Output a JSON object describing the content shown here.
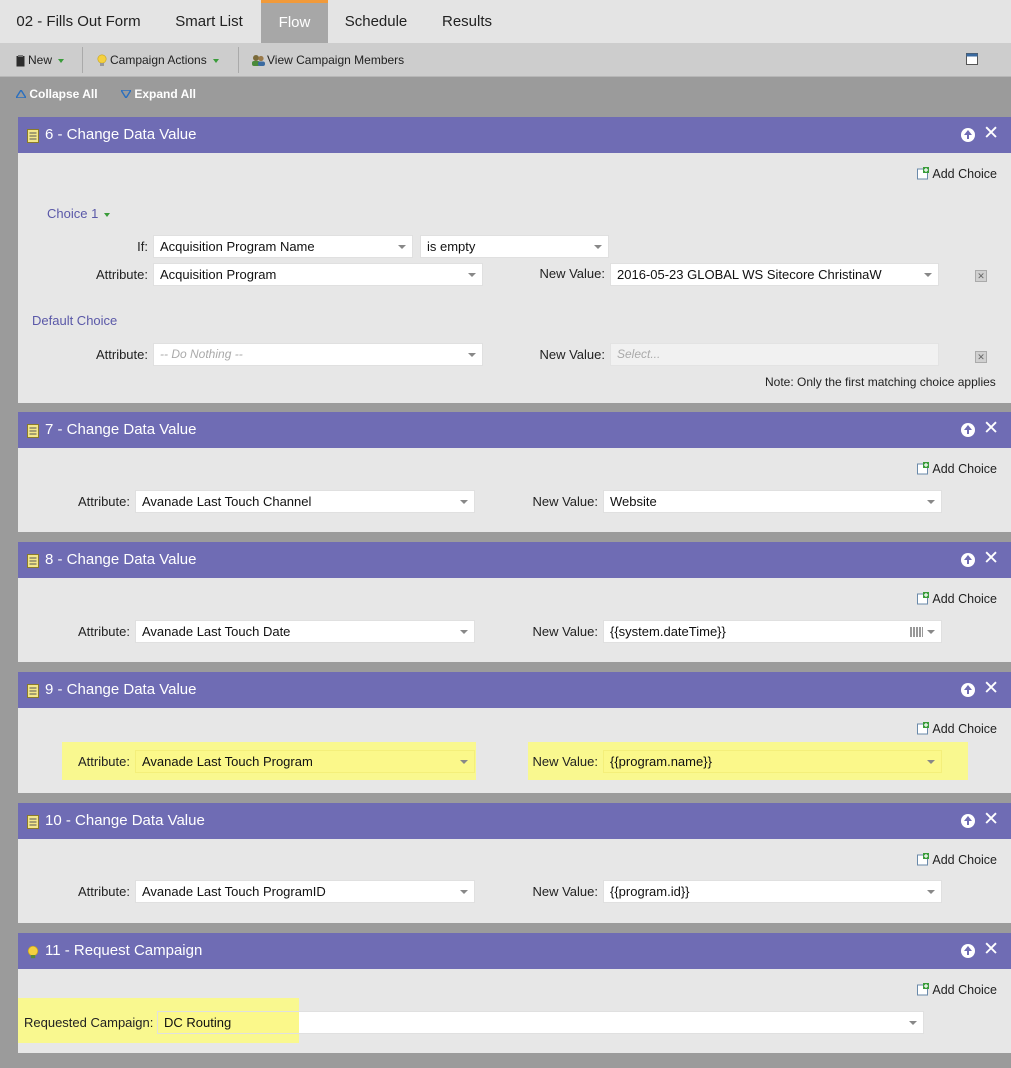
{
  "tabs": [
    {
      "label": "02 - Fills Out Form",
      "active": false
    },
    {
      "label": "Smart List",
      "active": false
    },
    {
      "label": "Flow",
      "active": true
    },
    {
      "label": "Schedule",
      "active": false
    },
    {
      "label": "Results",
      "active": false
    }
  ],
  "toolbar": {
    "new_label": "New",
    "campaign_actions_label": "Campaign Actions",
    "view_members_label": "View Campaign Members"
  },
  "subbar": {
    "collapse_all": "Collapse All",
    "expand_all": "Expand All"
  },
  "colors": {
    "header": "#6f6cb4",
    "highlight": "#fbf88a",
    "active_tab_accent": "#f19a3a"
  },
  "common": {
    "add_choice": "Add Choice",
    "attribute_label": "Attribute:",
    "new_value_label": "New Value:",
    "if_label": "If:"
  },
  "steps": [
    {
      "title": "6 - Change Data Value",
      "choice1_label": "Choice 1",
      "if_field": "Acquisition Program Name",
      "if_operator": "is empty",
      "attribute": "Acquisition Program",
      "new_value": "2016-05-23 GLOBAL WS Sitecore ChristinaW",
      "default_label": "Default Choice",
      "default_attribute": "-- Do Nothing --",
      "default_new_value": "Select...",
      "note": "Note: Only the first matching choice applies"
    },
    {
      "title": "7 - Change Data Value",
      "attribute": "Avanade Last Touch Channel",
      "new_value": "Website"
    },
    {
      "title": "8 - Change Data Value",
      "attribute": "Avanade Last Touch Date",
      "new_value": "{{system.dateTime}}"
    },
    {
      "title": "9 - Change Data Value",
      "attribute": "Avanade Last Touch Program",
      "new_value": "{{program.name}}"
    },
    {
      "title": "10 - Change Data Value",
      "attribute": "Avanade Last Touch ProgramID",
      "new_value": "{{program.id}}"
    },
    {
      "title": "11 - Request Campaign",
      "requested_label": "Requested Campaign:",
      "requested_value": "DC Routing"
    }
  ]
}
